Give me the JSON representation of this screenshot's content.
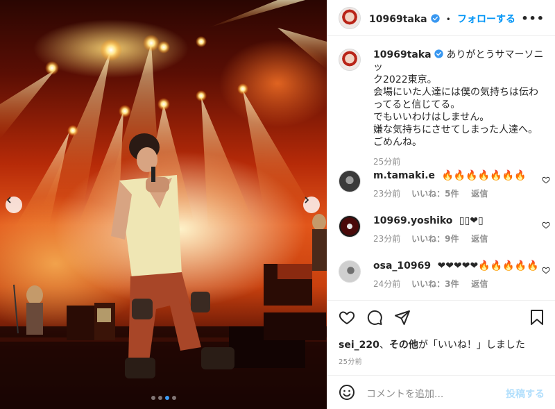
{
  "post": {
    "author": "10969taka",
    "follow_label": "フォローする",
    "dot_separator": "•",
    "more_label": "•••",
    "caption_lines": [
      "ありがとうサマーソニッ",
      "ク2022東京。",
      "会場にいた人達には僕の気持ちは伝わ",
      "ってると信じてる。",
      "でもいいわけはしません。",
      "嫌な気持ちにさせてしまった人達へ。",
      "ごめんね。"
    ],
    "caption_time": "25分前",
    "liked_by_prefix": "sei_220",
    "liked_by_middle": "、",
    "liked_by_others": "その他",
    "liked_by_suffix": "が「いいね！」しました",
    "post_time": "25分前",
    "carousel": {
      "slide_count": 4,
      "active_index": 2
    }
  },
  "comments": [
    {
      "user": "m.tamaki.e",
      "text": "🔥🔥🔥🔥🔥🔥🔥",
      "time": "23分前",
      "likes": "いいね：5件",
      "reply": "返信"
    },
    {
      "user": "10969.yoshiko",
      "text": "▯▯❤▯",
      "time": "23分前",
      "likes": "いいね：9件",
      "reply": "返信"
    },
    {
      "user": "osa_10969",
      "text": "❤❤❤❤❤🔥🔥🔥🔥🔥",
      "time": "24分前",
      "likes": "いいね：3件",
      "reply": "返信"
    }
  ],
  "composer": {
    "placeholder": "コメントを追加...",
    "post_label": "投稿する"
  },
  "colors": {
    "accent": "#0095f6",
    "verified": "#3897f0",
    "muted": "#8e8e8e",
    "disabled_post": "#b2dffc"
  },
  "icons": [
    "verified-icon",
    "more-icon",
    "heart-icon",
    "comment-icon",
    "share-icon",
    "bookmark-icon",
    "emoji-icon",
    "chevron-left-icon",
    "chevron-right-icon"
  ]
}
